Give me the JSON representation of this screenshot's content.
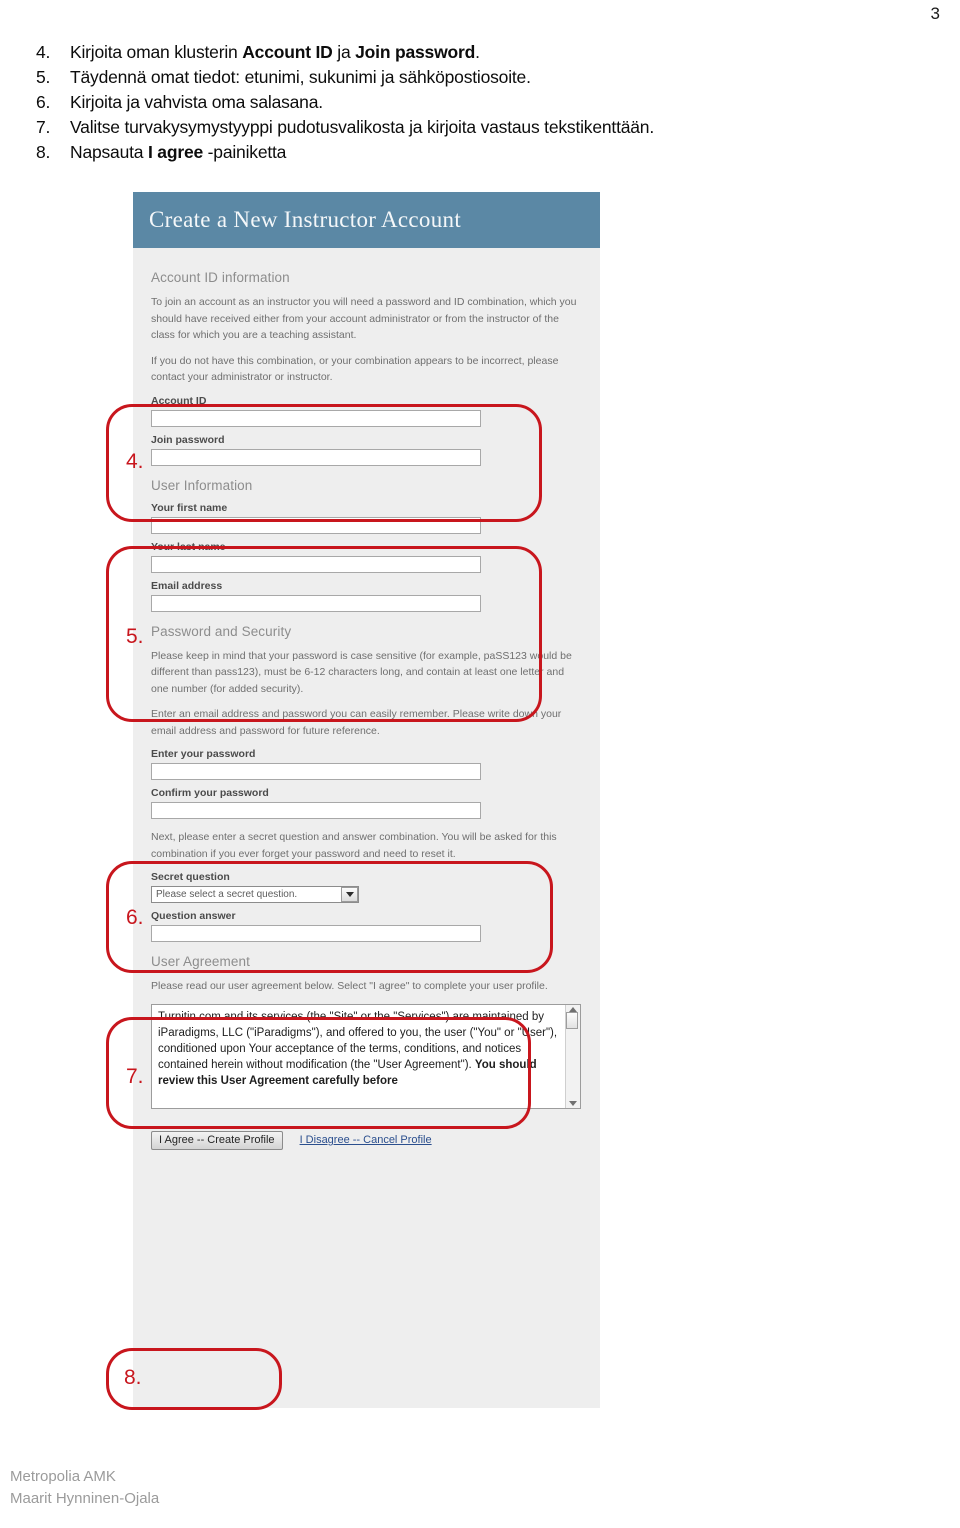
{
  "page": {
    "number": "3"
  },
  "instructions": [
    {
      "num": "4.",
      "pre": "Kirjoita oman klusterin ",
      "bold1": "Account ID",
      "mid": " ja ",
      "bold2": "Join password",
      "post": "."
    },
    {
      "num": "5.",
      "pre": "Täydennä omat tiedot: etunimi, sukunimi ja sähköpostiosoite.",
      "bold1": "",
      "mid": "",
      "bold2": "",
      "post": ""
    },
    {
      "num": "6.",
      "pre": "Kirjoita ja vahvista oma salasana.",
      "bold1": "",
      "mid": "",
      "bold2": "",
      "post": ""
    },
    {
      "num": "7.",
      "pre": "Valitse turvakysymystyyppi pudotusvalikosta ja kirjoita vastaus tekstikenttään.",
      "bold1": "",
      "mid": "",
      "bold2": "",
      "post": ""
    },
    {
      "num": "8.",
      "pre": "Napsauta ",
      "bold1": "I agree",
      "mid": " -painiketta",
      "bold2": "",
      "post": ""
    }
  ],
  "screenshot": {
    "header_title": "Create a New Instructor Account",
    "sections": {
      "account_id": {
        "heading": "Account ID information",
        "para1": "To join an account as an instructor you will need a password and ID combination, which you should have received either from your account administrator or from the instructor of the class for which you are a teaching assistant.",
        "para2": "If you do not have this combination, or your combination appears to be incorrect, please contact your administrator or instructor.",
        "label_account_id": "Account ID",
        "label_join_password": "Join password"
      },
      "user_information": {
        "heading": "User Information",
        "label_first_name": "Your first name",
        "label_last_name": "Your last name",
        "label_email": "Email address"
      },
      "password_security": {
        "heading": "Password and Security",
        "para1": "Please keep in mind that your password is case sensitive (for example, paSS123 would be different than pass123), must be 6-12 characters long, and contain at least one letter and one number (for added security).",
        "para2": "Enter an email address and password you can easily remember. Please write down your email address and password for future reference.",
        "label_enter_password": "Enter your password",
        "label_confirm_password": "Confirm your password",
        "para3": "Next, please enter a secret question and answer combination. You will be asked for this combination if you ever forget your password and need to reset it.",
        "label_secret_question": "Secret question",
        "secret_question_value": "Please select a secret question.",
        "label_question_answer": "Question answer"
      },
      "user_agreement": {
        "heading": "User Agreement",
        "para1": "Please read our user agreement below. Select \"I agree\" to complete your user profile.",
        "agreement_body": "Turnitin.com and its services (the \"Site\" or the \"Services\") are maintained by iParadigms, LLC (\"iParadigms\"), and offered to you, the user (\"You\" or \"User\"), conditioned upon Your acceptance of the terms, conditions, and notices contained herein without modification (the \"User Agreement\").",
        "agreement_bold_line": "You should review this User Agreement carefully before",
        "agree_button": "I Agree -- Create Profile",
        "disagree_link": "I Disagree -- Cancel Profile"
      }
    }
  },
  "annotations": [
    {
      "label": "4."
    },
    {
      "label": "5."
    },
    {
      "label": "6."
    },
    {
      "label": "7."
    },
    {
      "label": "8."
    }
  ],
  "footer": {
    "line1": "Metropolia AMK",
    "line2": "Maarit Hynninen-Ojala"
  },
  "colors": {
    "header_blue": "#5b88a5",
    "annotation_red": "#c8161d",
    "panel_gray": "#eeeeee",
    "footer_gray": "#9b9b9b"
  }
}
